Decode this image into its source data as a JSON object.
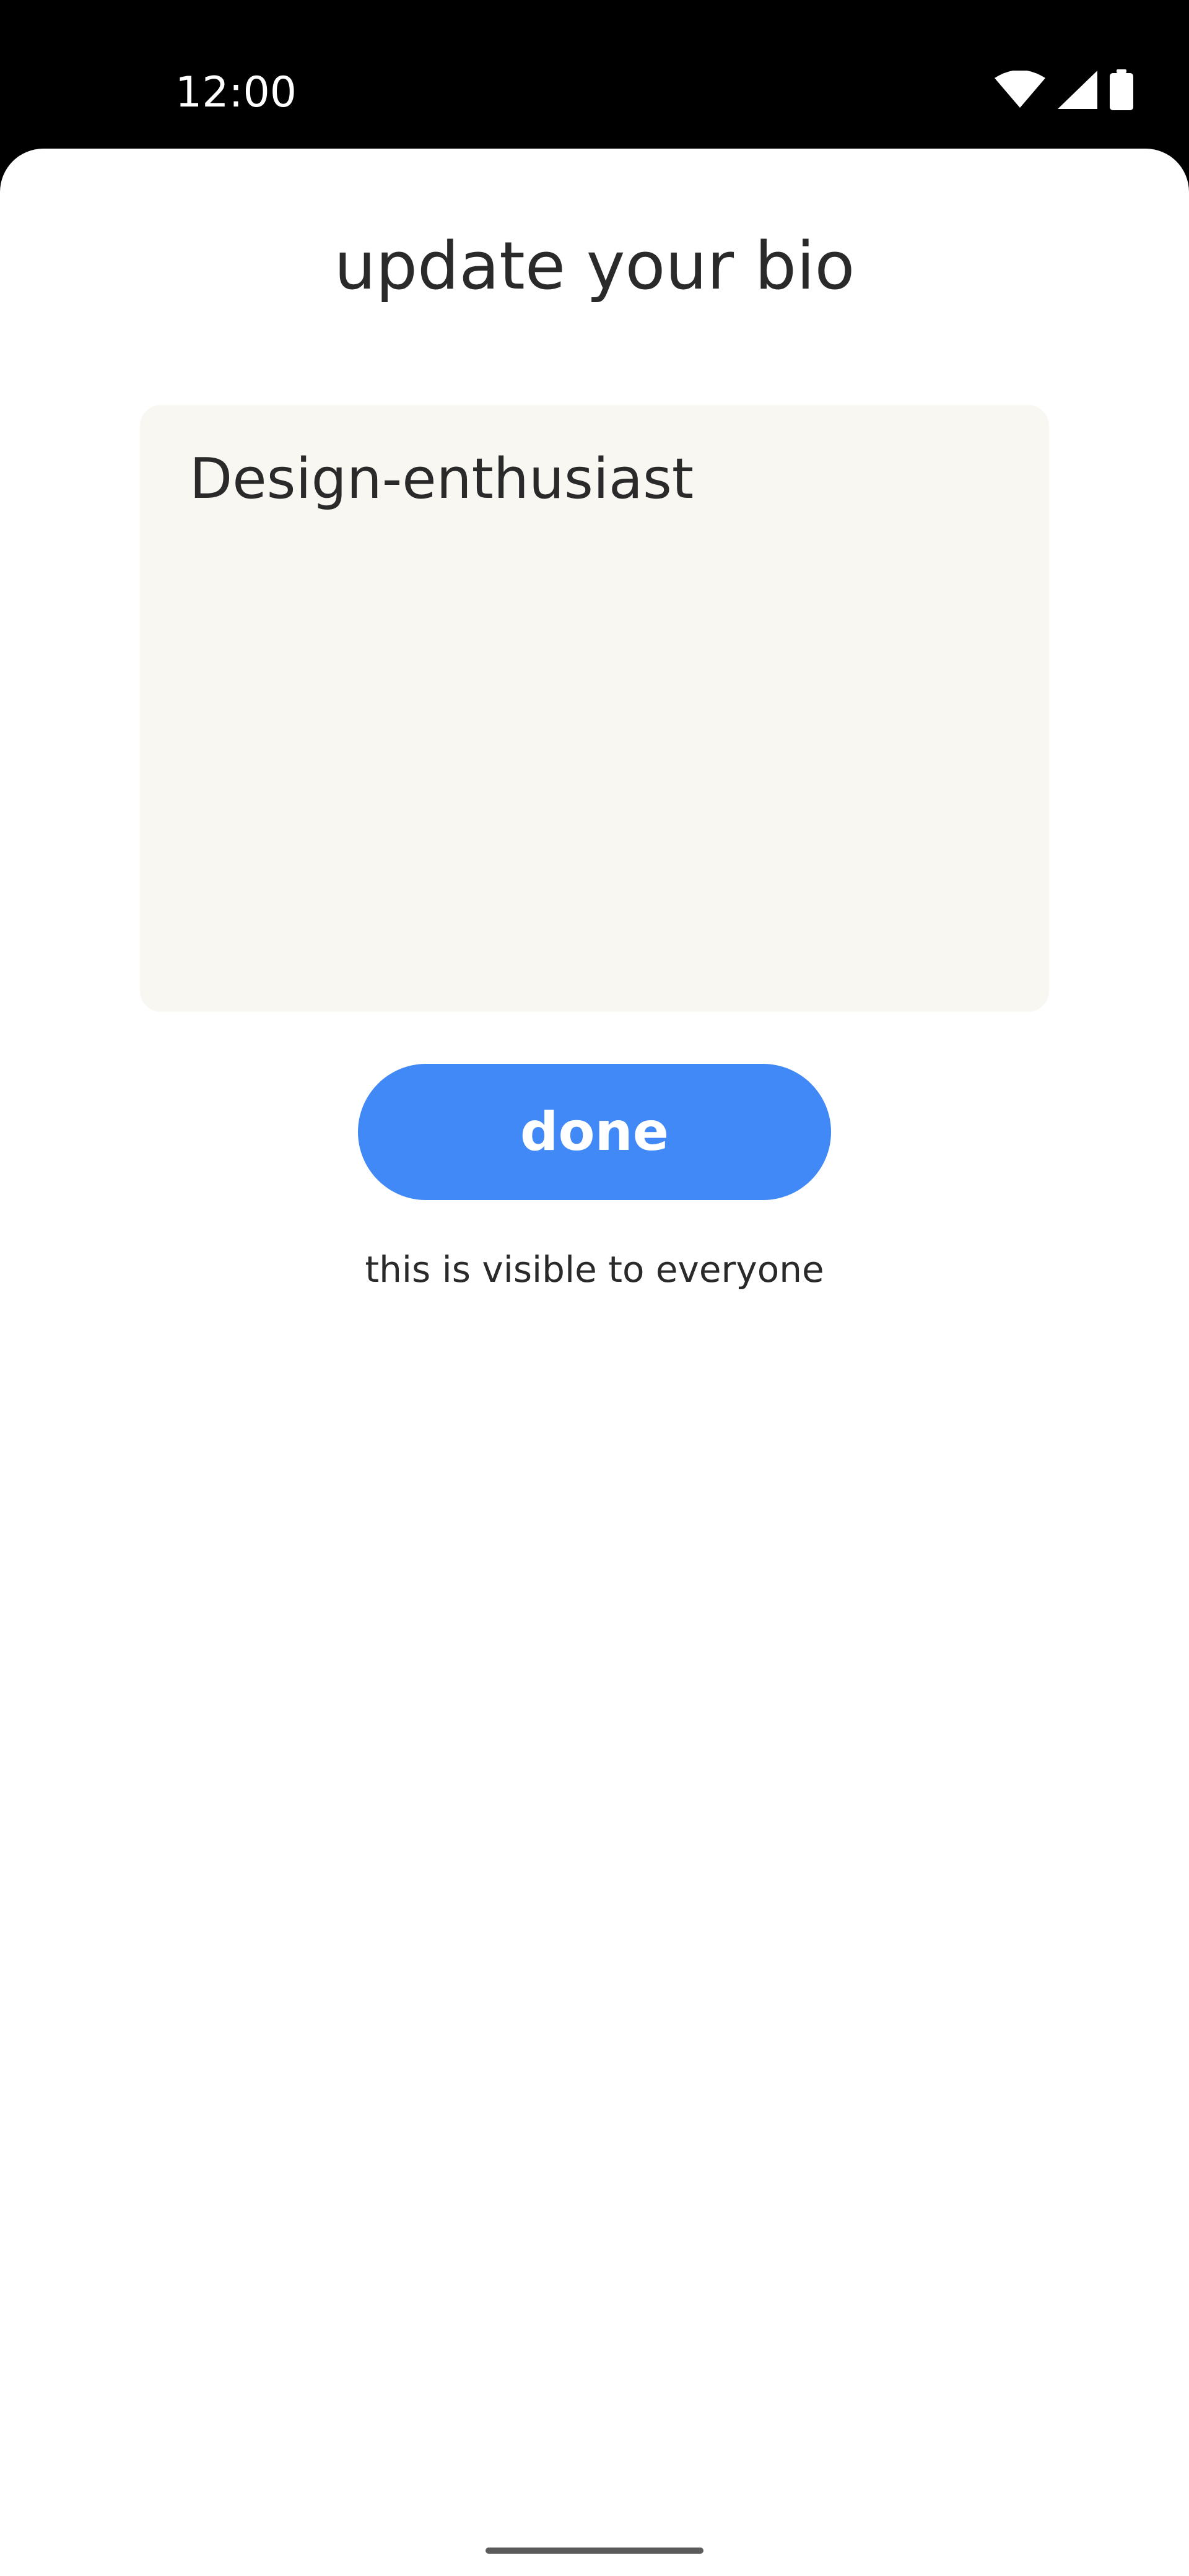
{
  "status_bar": {
    "time": "12:00",
    "icons": [
      "wifi-icon",
      "cellular-signal-icon",
      "battery-icon"
    ]
  },
  "screen": {
    "title": "update your bio",
    "bio_value": "Design-enthusiast",
    "done_label": "done",
    "visibility_note": "this is visible to everyone"
  },
  "colors": {
    "accent": "#4189f6",
    "input_background": "#f9f7f1",
    "text": "#2a2a2a",
    "status_bar_background": "#000000"
  }
}
